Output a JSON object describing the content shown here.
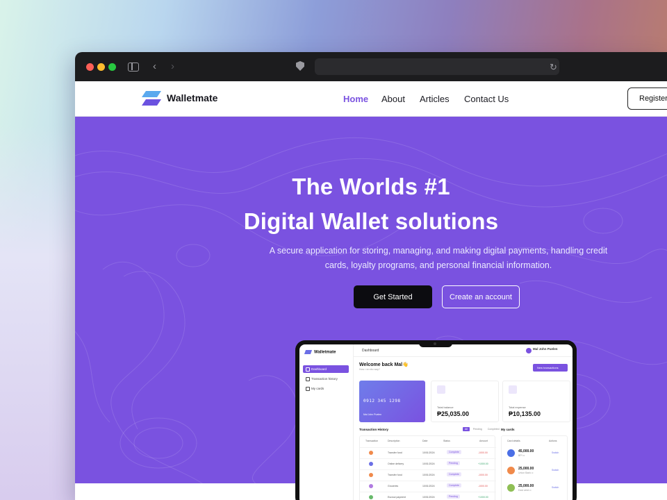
{
  "browser": {
    "url": ""
  },
  "nav": {
    "brand": "Walletmate",
    "links": [
      {
        "label": "Home",
        "active": true
      },
      {
        "label": "About"
      },
      {
        "label": "Articles"
      },
      {
        "label": "Contact Us"
      }
    ],
    "register_label": "Register"
  },
  "hero": {
    "title_line1": "The Worlds #1",
    "title_line2": "Digital Wallet solutions",
    "subtitle": "A secure application for storing, managing, and making digital payments, handling credit cards, loyalty programs, and personal financial information.",
    "primary_cta": "Get Started",
    "secondary_cta": "Create an account"
  },
  "colors": {
    "accent": "#7a52e0",
    "dark_button": "#0c0c10"
  },
  "dashboard_preview": {
    "brand": "Walletmate",
    "header_title": "Dashboard",
    "user_name": "Mal John Puelen",
    "sidebar": [
      "Dashboard",
      "Transaction history",
      "My cards"
    ],
    "welcome": "Welcome back Mal👋",
    "welcome_sub": "How r ve ebo way?",
    "new_tx_button": "New transactions",
    "card_number": "0912 345 1298",
    "card_holder": "Mal John Puelen",
    "total_balance_label": "Total balance",
    "total_balance": "₱25,035.00",
    "total_expense_label": "Total expense",
    "total_expense": "₱10,135.00",
    "history_title": "Transaction History",
    "tabs": [
      "All",
      "Pending",
      "Completed"
    ],
    "table_headers": [
      "Transaction",
      "Description",
      "Date",
      "Status",
      "Amount"
    ],
    "rows": [
      {
        "desc": "Transfer fund",
        "date": "10/01/2024",
        "status": "Complete",
        "amount": "-1000.00",
        "color": "#f08a4b"
      },
      {
        "desc": "Online delivery",
        "date": "10/01/2024",
        "status": "Pending",
        "amount": "+1000.00",
        "color": "#6b6fe6"
      },
      {
        "desc": "Transfer fund",
        "date": "10/01/2024",
        "status": "Complete",
        "amount": "-1000.00",
        "color": "#f08a4b"
      },
      {
        "desc": "Groceries",
        "date": "10/01/2024",
        "status": "Complete",
        "amount": "-1000.00",
        "color": "#b07be0"
      },
      {
        "desc": "Escrow payment",
        "date": "10/01/2024",
        "status": "Pending",
        "amount": "+1000.00",
        "color": "#67b96a"
      }
    ],
    "my_cards_title": "My cards",
    "my_cards_headers": [
      "Card details",
      "Actions"
    ],
    "my_cards": [
      {
        "amount": "45,000.00",
        "sub": "BPI ••",
        "action": "Switch",
        "color": "#4b6fe6"
      },
      {
        "amount": "25,000.00",
        "sub": "Union Bank ••",
        "action": "Switch",
        "color": "#f08a4b"
      },
      {
        "amount": "25,000.00",
        "sub": "East west ••",
        "action": "Switch",
        "color": "#8fbf55"
      }
    ]
  }
}
